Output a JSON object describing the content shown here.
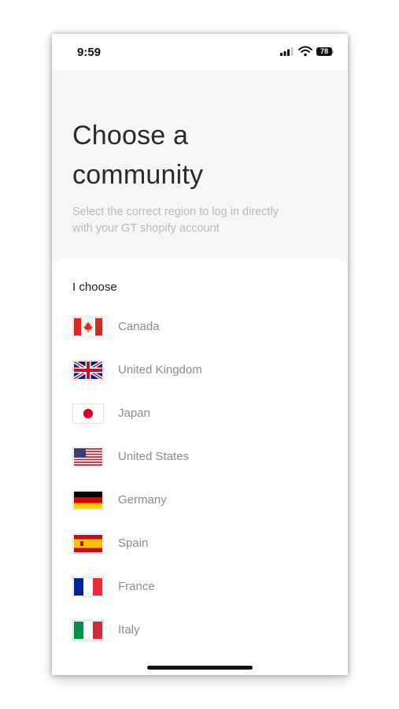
{
  "status": {
    "time": "9:59",
    "battery": "78"
  },
  "header": {
    "title_line1": "Choose a",
    "title_line2": "community",
    "subtitle_line1": "Select the correct region to log in directly",
    "subtitle_line2": "with your GT shopify account"
  },
  "list": {
    "label": "I choose",
    "countries": [
      {
        "name": "Canada",
        "flag_icon": "canada-flag-icon"
      },
      {
        "name": "United Kingdom",
        "flag_icon": "uk-flag-icon"
      },
      {
        "name": "Japan",
        "flag_icon": "japan-flag-icon"
      },
      {
        "name": "United States",
        "flag_icon": "us-flag-icon"
      },
      {
        "name": "Germany",
        "flag_icon": "germany-flag-icon"
      },
      {
        "name": "Spain",
        "flag_icon": "spain-flag-icon"
      },
      {
        "name": "France",
        "flag_icon": "france-flag-icon"
      },
      {
        "name": "Italy",
        "flag_icon": "italy-flag-icon"
      }
    ]
  },
  "colors": {
    "background": "#f7f7f7",
    "card": "#ffffff",
    "title": "#2a2a2a",
    "subtitle": "#b9b9b9",
    "country_text": "#8c8c8c"
  }
}
